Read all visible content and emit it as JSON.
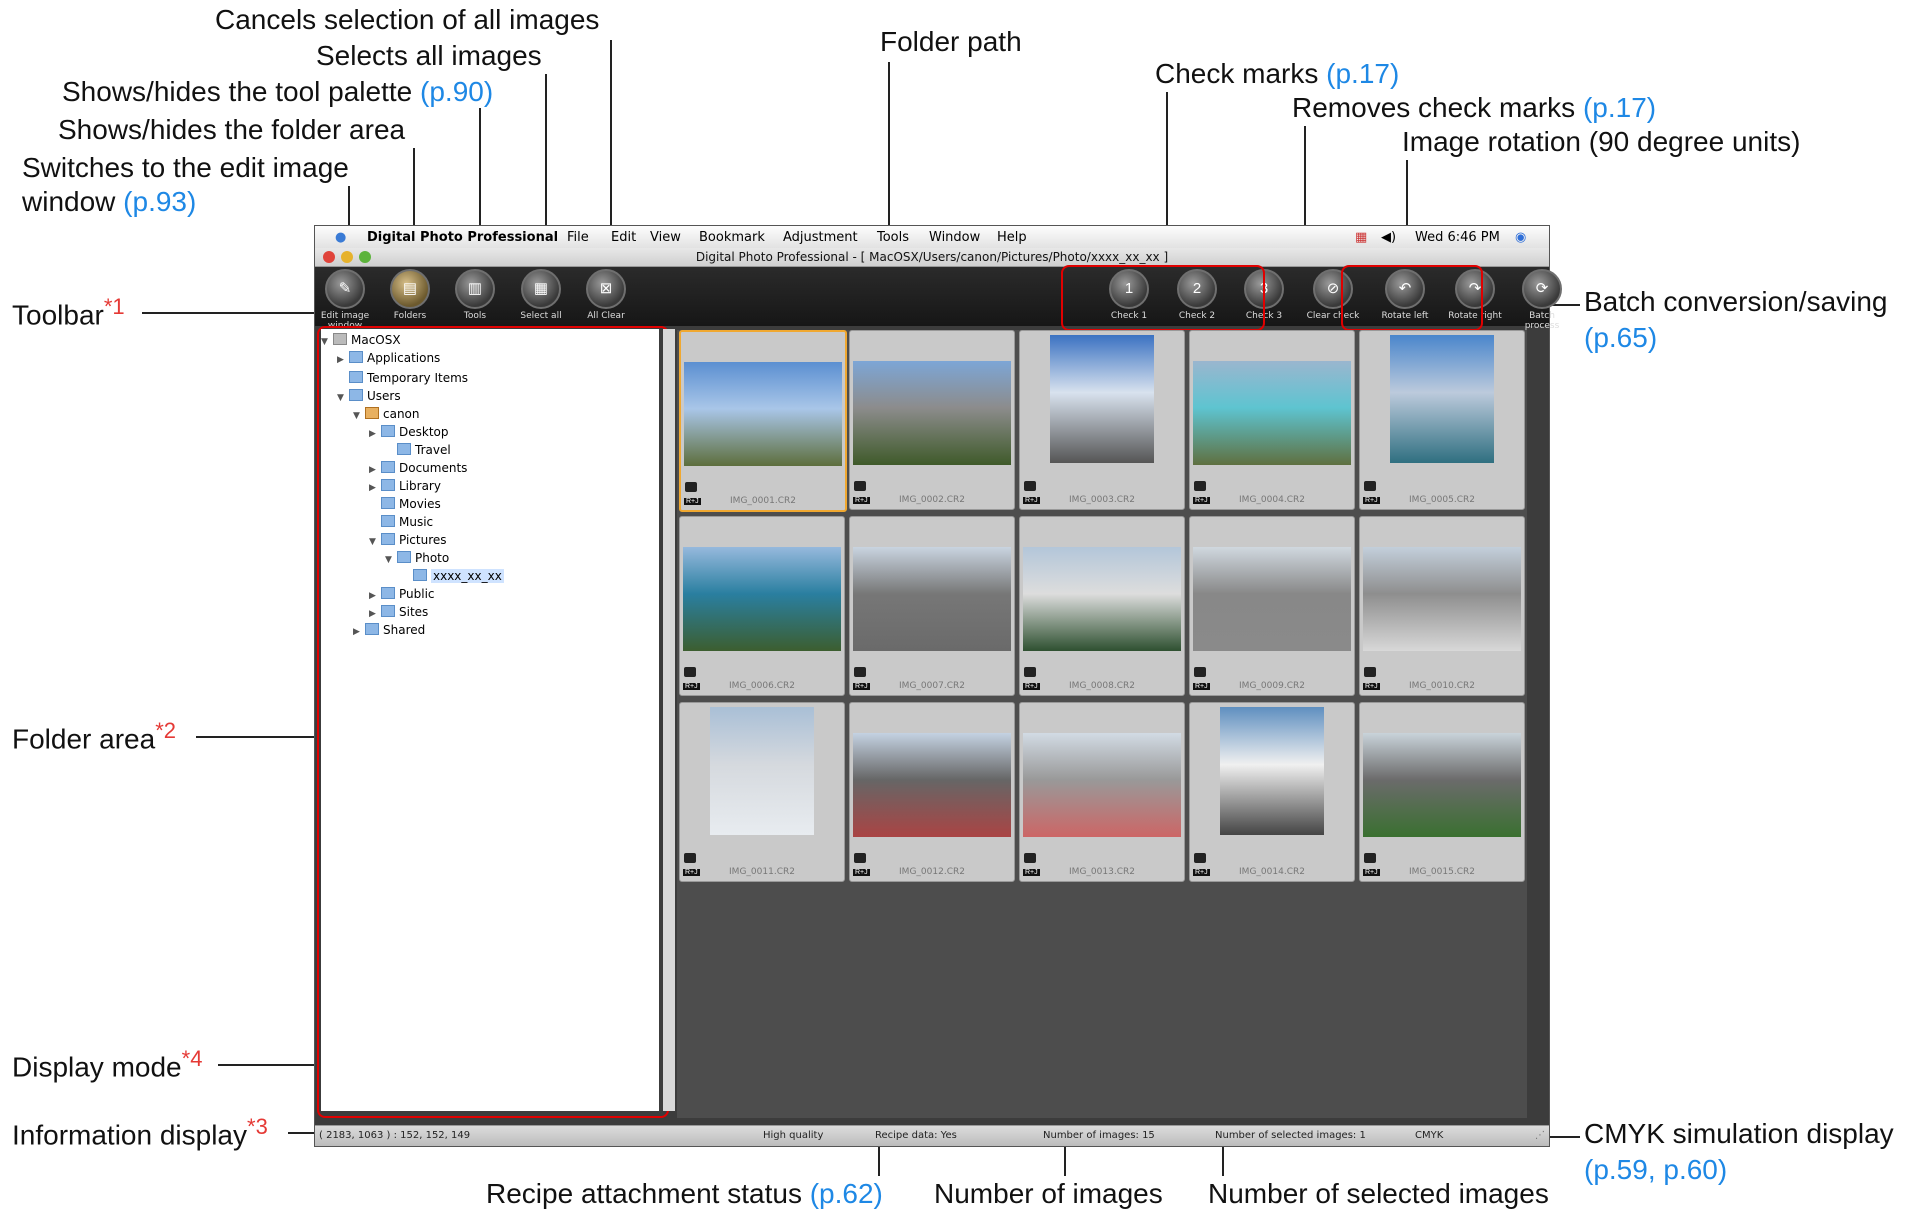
{
  "annotations": {
    "cancel_all": {
      "text": "Cancels selection of all images"
    },
    "select_all": {
      "text": "Selects all images"
    },
    "tool_palette": {
      "text": "Shows/hides the tool palette",
      "ref": "(p.90)"
    },
    "folder_area_toggle": {
      "text": "Shows/hides the folder area"
    },
    "edit_window": {
      "text1": "Switches to the edit image",
      "text2": "window",
      "ref": "(p.93)"
    },
    "toolbar": {
      "text": "Toolbar",
      "mark": "*1"
    },
    "folder_area": {
      "text": "Folder area",
      "mark": "*2"
    },
    "display_mode": {
      "text": "Display mode",
      "mark": "*4"
    },
    "info_display": {
      "text": "Information display",
      "mark": "*3"
    },
    "folder_path": {
      "text": "Folder path"
    },
    "check_marks": {
      "text": "Check marks",
      "ref": "(p.17)"
    },
    "remove_checks": {
      "text": "Removes check marks",
      "ref": "(p.17)"
    },
    "rotation": {
      "text": "Image rotation (90 degree units)"
    },
    "batch": {
      "text": "Batch conversion/saving",
      "ref": "(p.65)"
    },
    "cmyk": {
      "text": "CMYK simulation display",
      "ref": "(p.59, p.60)"
    },
    "recipe": {
      "text": "Recipe attachment status",
      "ref": "(p.62)"
    },
    "num_images": {
      "text": "Number of images"
    },
    "num_selected": {
      "text": "Number of selected images"
    }
  },
  "menubar": {
    "app": "Digital Photo Professional",
    "items": [
      "File",
      "Edit",
      "View",
      "Bookmark",
      "Adjustment",
      "Tools",
      "Window",
      "Help"
    ],
    "clock": "Wed 6:46 PM"
  },
  "window_title": "Digital Photo Professional - [ MacOSX/Users/canon/Pictures/Photo/xxxx_xx_xx ]",
  "toolbar": {
    "edit_image": "Edit image window",
    "folders": "Folders",
    "tools": "Tools",
    "select_all": "Select all",
    "all_clear": "All Clear",
    "check1": "Check 1",
    "check2": "Check 2",
    "check3": "Check 3",
    "clear_check": "Clear check",
    "rotate_left": "Rotate left",
    "rotate_right": "Rotate right",
    "batch": "Batch process"
  },
  "tree": [
    "MacOSX",
    "Applications",
    "Temporary Items",
    "Users",
    "canon",
    "Desktop",
    "Travel",
    "Documents",
    "Library",
    "Movies",
    "Music",
    "Pictures",
    "Photo",
    "xxxx_xx_xx",
    "Public",
    "Sites",
    "Shared"
  ],
  "images": [
    "IMG_0001.CR2",
    "IMG_0002.CR2",
    "IMG_0003.CR2",
    "IMG_0004.CR2",
    "IMG_0005.CR2",
    "IMG_0006.CR2",
    "IMG_0007.CR2",
    "IMG_0008.CR2",
    "IMG_0009.CR2",
    "IMG_0010.CR2",
    "IMG_0011.CR2",
    "IMG_0012.CR2",
    "IMG_0013.CR2",
    "IMG_0014.CR2",
    "IMG_0015.CR2"
  ],
  "badge": "R+J",
  "status": {
    "info": "( 2183, 1063 ) : 152, 152, 149",
    "quality": "High quality",
    "recipe": "Recipe data: Yes",
    "count": "Number of images: 15",
    "selected": "Number of selected images: 1",
    "cmyk": "CMYK"
  },
  "colors": {
    "annotation_ref": "#1e88e5",
    "annotation_mark": "#e53935",
    "highlight_box": "#e10000",
    "selection": "#f0a830"
  }
}
